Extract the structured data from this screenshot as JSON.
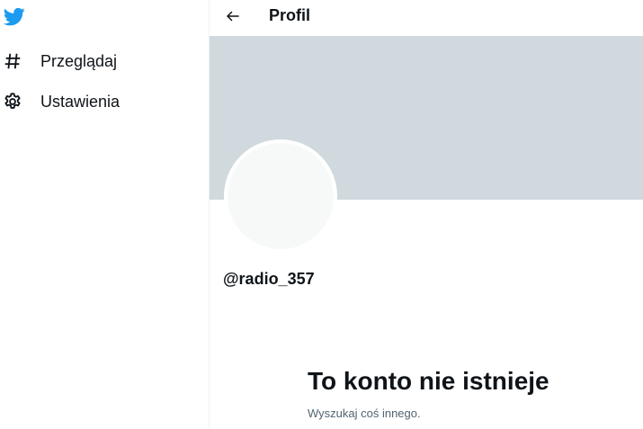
{
  "sidebar": {
    "logo_icon": "twitter-bird-icon",
    "items": [
      {
        "icon": "hashtag-icon",
        "label": "Przeglądaj"
      },
      {
        "icon": "gear-icon",
        "label": "Ustawienia"
      }
    ]
  },
  "header": {
    "back_icon": "arrow-left-icon",
    "title": "Profil"
  },
  "profile": {
    "handle": "@radio_357"
  },
  "empty_state": {
    "title": "To konto nie istnieje",
    "subtitle": "Wyszukaj coś innego."
  },
  "colors": {
    "brand": "#1d9bf0",
    "banner": "#cfd9de",
    "avatar": "#f7f9f9",
    "text_primary": "#0f1419",
    "text_secondary": "#536471"
  }
}
